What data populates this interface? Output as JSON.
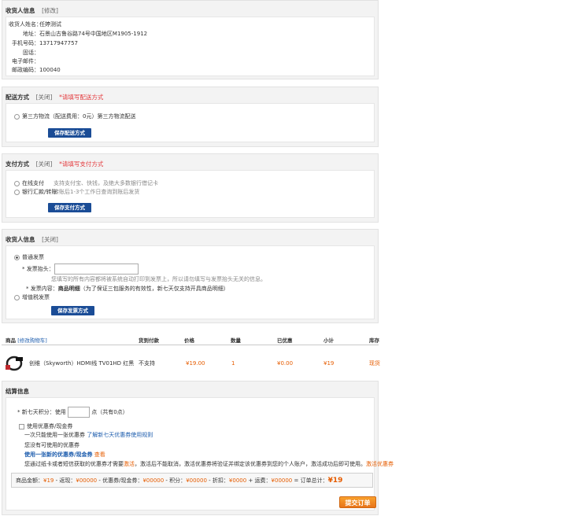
{
  "recipient": {
    "title": "收货人信息",
    "edit": "[修改]",
    "fields": [
      {
        "label": "收货人姓名：",
        "value": "任婷测试"
      },
      {
        "label": "地址：",
        "value": "石景山古鲁谷路74号中国地区M1905-1912"
      },
      {
        "label": "手机号码：",
        "value": "13717947757"
      },
      {
        "label": "固话：",
        "value": ""
      },
      {
        "label": "电子邮件：",
        "value": ""
      },
      {
        "label": "邮政编码：",
        "value": "100040"
      }
    ]
  },
  "shipping": {
    "title": "配送方式",
    "close": "[关闭]",
    "required": "*请填写配送方式",
    "option": "第三方物流（配送费用：0元）第三方物流配送",
    "save": "保存配送方式"
  },
  "payment": {
    "title": "支付方式",
    "close": "[关闭]",
    "required": "*请填写支付方式",
    "options": [
      {
        "name": "在线支付",
        "desc": "支持支付宝、快钱，及绝大多数银行借记卡"
      },
      {
        "name": "银行汇款/转账",
        "desc": "转账后1-3个工作日查询到账后发货"
      }
    ],
    "save": "保存支付方式"
  },
  "invoice": {
    "title": "收货人信息",
    "close": "[关闭]",
    "normal": "普通发票",
    "header_label": "* 发票抬头：",
    "header_value": "",
    "notice": "您填写的所有内容都将被系统自动打印到发票上，所以请勿填写与发票抬头无关的信息。",
    "content_label": "* 发票内容：",
    "content_value": "商品明细",
    "content_note": "（为了保证三包服务的有效性，新七天仅支持开具商品明细）",
    "vat": "增值税发票",
    "save": "保存发票方式"
  },
  "goods": {
    "headers": {
      "product": "商品",
      "back_to_cart": "[修改购物车]",
      "cod": "货到付款",
      "price": "价格",
      "qty": "数量",
      "discount": "已优惠",
      "subtotal": "小计",
      "stock": "库存"
    },
    "items": [
      {
        "name": "创维（Skyworth）HDMI线 TV01HD 红黑",
        "cod": "不支持",
        "price": "¥19.00",
        "qty": "1",
        "discount": "¥0.00",
        "subtotal": "¥19",
        "stock": "现货"
      }
    ]
  },
  "settle": {
    "title": "结算信息",
    "points_label": "* 新七天积分：使用",
    "points_value": "",
    "points_unit": "点（共有0点）",
    "coupon_check": "使用优惠券/现金券",
    "coupon_rule": "一次只能使用一张优惠券",
    "coupon_link": "了解新七天优惠券使用规则",
    "no_coupon": "您没有可使用的优惠券",
    "use_new": "使用一张新的优惠券/现金券",
    "view": "查看",
    "activate_note_a": "您通过纸卡或者短信获取的优惠券才需要",
    "activate_word": "激活",
    "activate_note_b": "，激活后不能取消，激活优惠券将验证并绑定该优惠券到您的个人账户，激活成功后即可使用。",
    "activate_link": "激活优惠券",
    "summary": {
      "goods_label": "商品金额：",
      "goods_value": "¥19",
      "refund_label": "- 返现：",
      "refund_value": "¥00000",
      "coupon_label": "- 优惠券/现金券：",
      "coupon_value": "¥00000",
      "points_label": "- 积分：",
      "points_value": "¥00000",
      "rebate_label": "- 折扣：",
      "rebate_value": "¥0000",
      "freight_label": "+ 运费：",
      "freight_value": "¥00000",
      "total_label": "= 订单总计：",
      "total_value": "¥19"
    },
    "submit": "提交订单"
  }
}
